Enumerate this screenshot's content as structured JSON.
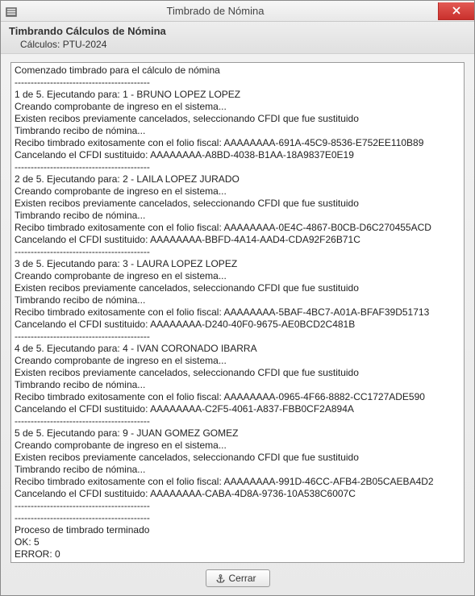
{
  "titlebar": {
    "title": "Timbrado de Nómina"
  },
  "header": {
    "title": "Timbrando Cálculos de Nómina",
    "subtitle": "Cálculos: PTU-2024"
  },
  "log": {
    "lines": [
      "Comenzado timbrado para el cálculo de nómina",
      "------------------------------------------",
      "1 de 5. Ejecutando para: 1 - BRUNO LOPEZ LOPEZ",
      "Creando comprobante de ingreso en el sistema...",
      "Existen recibos previamente cancelados, seleccionando CFDI que fue sustituido",
      "Timbrando recibo de nómina...",
      "Recibo timbrado exitosamente con el folio fiscal: AAAAAAAA-691A-45C9-8536-E752EE110B89",
      "Cancelando el CFDI sustituido: AAAAAAAA-A8BD-4038-B1AA-18A9837E0E19",
      "------------------------------------------",
      "2 de 5. Ejecutando para: 2 - LAILA LOPEZ JURADO",
      "Creando comprobante de ingreso en el sistema...",
      "Existen recibos previamente cancelados, seleccionando CFDI que fue sustituido",
      "Timbrando recibo de nómina...",
      "Recibo timbrado exitosamente con el folio fiscal: AAAAAAAA-0E4C-4867-B0CB-D6C270455ACD",
      "Cancelando el CFDI sustituido: AAAAAAAA-BBFD-4A14-AAD4-CDA92F26B71C",
      "------------------------------------------",
      "3 de 5. Ejecutando para: 3 - LAURA LOPEZ LOPEZ",
      "Creando comprobante de ingreso en el sistema...",
      "Existen recibos previamente cancelados, seleccionando CFDI que fue sustituido",
      "Timbrando recibo de nómina...",
      "Recibo timbrado exitosamente con el folio fiscal: AAAAAAAA-5BAF-4BC7-A01A-BFAF39D51713",
      "Cancelando el CFDI sustituido: AAAAAAAA-D240-40F0-9675-AE0BCD2C481B",
      "------------------------------------------",
      "4 de 5. Ejecutando para: 4 - IVAN CORONADO IBARRA",
      "Creando comprobante de ingreso en el sistema...",
      "Existen recibos previamente cancelados, seleccionando CFDI que fue sustituido",
      "Timbrando recibo de nómina...",
      "Recibo timbrado exitosamente con el folio fiscal: AAAAAAAA-0965-4F66-8882-CC1727ADE590",
      "Cancelando el CFDI sustituido: AAAAAAAA-C2F5-4061-A837-FBB0CF2A894A",
      "------------------------------------------",
      "5 de 5. Ejecutando para: 9 - JUAN GOMEZ GOMEZ",
      "Creando comprobante de ingreso en el sistema...",
      "Existen recibos previamente cancelados, seleccionando CFDI que fue sustituido",
      "Timbrando recibo de nómina...",
      "Recibo timbrado exitosamente con el folio fiscal: AAAAAAAA-991D-46CC-AFB4-2B05CAEBA4D2",
      "Cancelando el CFDI sustituido: AAAAAAAA-CABA-4D8A-9736-10A538C6007C",
      "------------------------------------------",
      "------------------------------------------",
      "Proceso de timbrado terminado",
      "OK: 5",
      "ERROR: 0"
    ]
  },
  "buttons": {
    "close": "Cerrar"
  }
}
